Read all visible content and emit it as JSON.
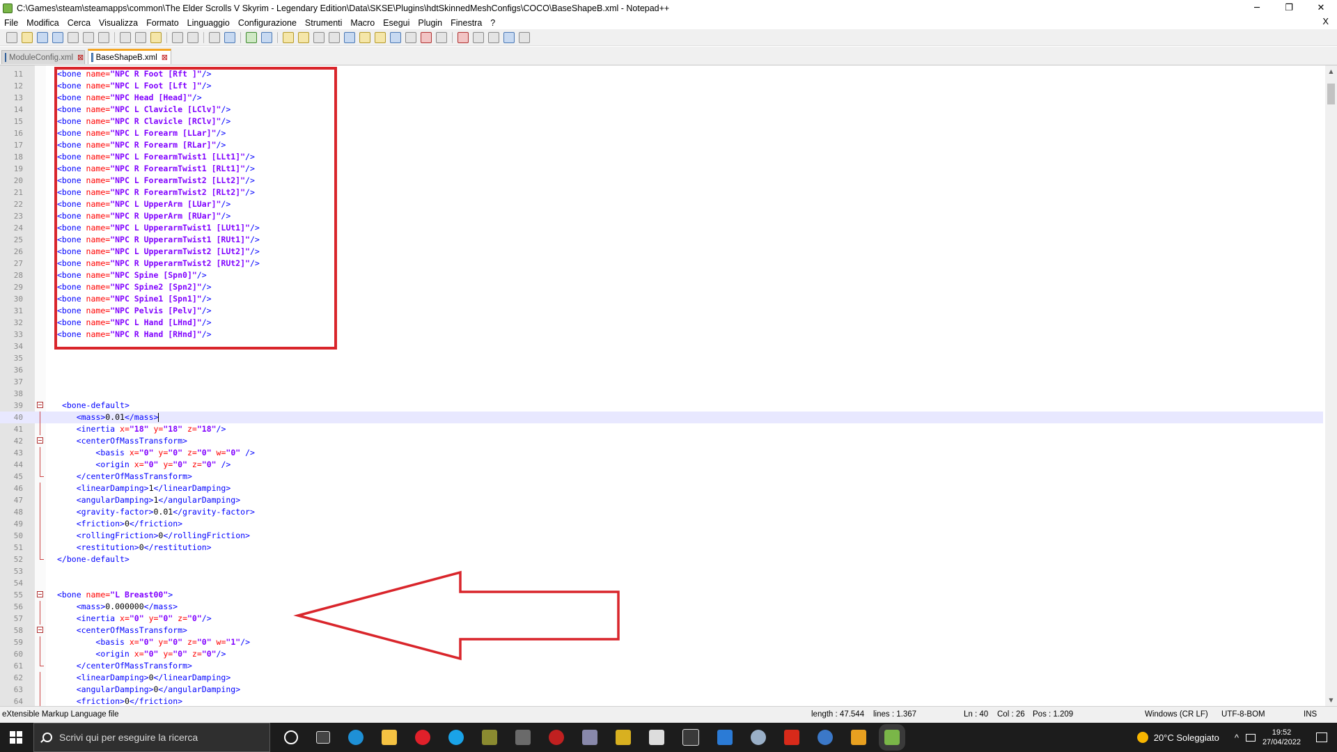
{
  "window": {
    "title": "C:\\Games\\steam\\steamapps\\common\\The Elder Scrolls V Skyrim - Legendary Edition\\Data\\SKSE\\Plugins\\hdtSkinnedMeshConfigs\\COCO\\BaseShapeB.xml - Notepad++",
    "minimize": "─",
    "restore": "❐",
    "close": "✕"
  },
  "menu": {
    "items": [
      "File",
      "Modifica",
      "Cerca",
      "Visualizza",
      "Formato",
      "Linguaggio",
      "Configurazione",
      "Strumenti",
      "Macro",
      "Esegui",
      "Plugin",
      "Finestra",
      "?"
    ],
    "close_doc": "X"
  },
  "tabs": [
    {
      "label": "ModuleConfig.xml",
      "active": false
    },
    {
      "label": "BaseShapeB.xml",
      "active": true
    }
  ],
  "tab_close_glyph": "⊠",
  "editor": {
    "current_line": 40,
    "lines": [
      {
        "n": "11",
        "indent": "",
        "tokens": [
          [
            "tg",
            "<bone "
          ],
          [
            "at",
            "name="
          ],
          [
            "av",
            "\"NPC R Foot [Rft ]\""
          ],
          [
            "tg",
            "/>"
          ]
        ]
      },
      {
        "n": "12",
        "indent": "",
        "tokens": [
          [
            "tg",
            "<bone "
          ],
          [
            "at",
            "name="
          ],
          [
            "av",
            "\"NPC L Foot [Lft ]\""
          ],
          [
            "tg",
            "/>"
          ]
        ]
      },
      {
        "n": "13",
        "indent": "",
        "tokens": [
          [
            "tg",
            "<bone "
          ],
          [
            "at",
            "name="
          ],
          [
            "av",
            "\"NPC Head [Head]\""
          ],
          [
            "tg",
            "/>"
          ]
        ]
      },
      {
        "n": "14",
        "indent": "",
        "tokens": [
          [
            "tg",
            "<bone "
          ],
          [
            "at",
            "name="
          ],
          [
            "av",
            "\"NPC L Clavicle [LClv]\""
          ],
          [
            "tg",
            "/>"
          ]
        ]
      },
      {
        "n": "15",
        "indent": "",
        "tokens": [
          [
            "tg",
            "<bone "
          ],
          [
            "at",
            "name="
          ],
          [
            "av",
            "\"NPC R Clavicle [RClv]\""
          ],
          [
            "tg",
            "/>"
          ]
        ]
      },
      {
        "n": "16",
        "indent": "",
        "tokens": [
          [
            "tg",
            "<bone "
          ],
          [
            "at",
            "name="
          ],
          [
            "av",
            "\"NPC L Forearm [LLar]\""
          ],
          [
            "tg",
            "/>"
          ]
        ]
      },
      {
        "n": "17",
        "indent": "",
        "tokens": [
          [
            "tg",
            "<bone "
          ],
          [
            "at",
            "name="
          ],
          [
            "av",
            "\"NPC R Forearm [RLar]\""
          ],
          [
            "tg",
            "/>"
          ]
        ]
      },
      {
        "n": "18",
        "indent": "",
        "tokens": [
          [
            "tg",
            "<bone "
          ],
          [
            "at",
            "name="
          ],
          [
            "av",
            "\"NPC L ForearmTwist1 [LLt1]\""
          ],
          [
            "tg",
            "/>"
          ]
        ]
      },
      {
        "n": "19",
        "indent": "",
        "tokens": [
          [
            "tg",
            "<bone "
          ],
          [
            "at",
            "name="
          ],
          [
            "av",
            "\"NPC R ForearmTwist1 [RLt1]\""
          ],
          [
            "tg",
            "/>"
          ]
        ]
      },
      {
        "n": "20",
        "indent": "",
        "tokens": [
          [
            "tg",
            "<bone "
          ],
          [
            "at",
            "name="
          ],
          [
            "av",
            "\"NPC L ForearmTwist2 [LLt2]\""
          ],
          [
            "tg",
            "/>"
          ]
        ]
      },
      {
        "n": "21",
        "indent": "",
        "tokens": [
          [
            "tg",
            "<bone "
          ],
          [
            "at",
            "name="
          ],
          [
            "av",
            "\"NPC R ForearmTwist2 [RLt2]\""
          ],
          [
            "tg",
            "/>"
          ]
        ]
      },
      {
        "n": "22",
        "indent": "",
        "tokens": [
          [
            "tg",
            "<bone "
          ],
          [
            "at",
            "name="
          ],
          [
            "av",
            "\"NPC L UpperArm [LUar]\""
          ],
          [
            "tg",
            "/>"
          ]
        ]
      },
      {
        "n": "23",
        "indent": "",
        "tokens": [
          [
            "tg",
            "<bone "
          ],
          [
            "at",
            "name="
          ],
          [
            "av",
            "\"NPC R UpperArm [RUar]\""
          ],
          [
            "tg",
            "/>"
          ]
        ]
      },
      {
        "n": "24",
        "indent": "",
        "tokens": [
          [
            "tg",
            "<bone "
          ],
          [
            "at",
            "name="
          ],
          [
            "av",
            "\"NPC L UpperarmTwist1 [LUt1]\""
          ],
          [
            "tg",
            "/>"
          ]
        ]
      },
      {
        "n": "25",
        "indent": "",
        "tokens": [
          [
            "tg",
            "<bone "
          ],
          [
            "at",
            "name="
          ],
          [
            "av",
            "\"NPC R UpperarmTwist1 [RUt1]\""
          ],
          [
            "tg",
            "/>"
          ]
        ]
      },
      {
        "n": "26",
        "indent": "",
        "tokens": [
          [
            "tg",
            "<bone "
          ],
          [
            "at",
            "name="
          ],
          [
            "av",
            "\"NPC L UpperarmTwist2 [LUt2]\""
          ],
          [
            "tg",
            "/>"
          ]
        ]
      },
      {
        "n": "27",
        "indent": "",
        "tokens": [
          [
            "tg",
            "<bone "
          ],
          [
            "at",
            "name="
          ],
          [
            "av",
            "\"NPC R UpperarmTwist2 [RUt2]\""
          ],
          [
            "tg",
            "/>"
          ]
        ]
      },
      {
        "n": "28",
        "indent": "",
        "tokens": [
          [
            "tg",
            "<bone "
          ],
          [
            "at",
            "name="
          ],
          [
            "av",
            "\"NPC Spine [Spn0]\""
          ],
          [
            "tg",
            "/>"
          ]
        ]
      },
      {
        "n": "29",
        "indent": "",
        "tokens": [
          [
            "tg",
            "<bone "
          ],
          [
            "at",
            "name="
          ],
          [
            "av",
            "\"NPC Spine2 [Spn2]\""
          ],
          [
            "tg",
            "/>"
          ]
        ]
      },
      {
        "n": "30",
        "indent": "",
        "tokens": [
          [
            "tg",
            "<bone "
          ],
          [
            "at",
            "name="
          ],
          [
            "av",
            "\"NPC Spine1 [Spn1]\""
          ],
          [
            "tg",
            "/>"
          ]
        ]
      },
      {
        "n": "31",
        "indent": "",
        "tokens": [
          [
            "tg",
            "<bone "
          ],
          [
            "at",
            "name="
          ],
          [
            "av",
            "\"NPC Pelvis [Pelv]\""
          ],
          [
            "tg",
            "/>"
          ]
        ]
      },
      {
        "n": "32",
        "indent": "",
        "tokens": [
          [
            "tg",
            "<bone "
          ],
          [
            "at",
            "name="
          ],
          [
            "av",
            "\"NPC L Hand [LHnd]\""
          ],
          [
            "tg",
            "/>"
          ]
        ]
      },
      {
        "n": "33",
        "indent": "",
        "tokens": [
          [
            "tg",
            "<bone "
          ],
          [
            "at",
            "name="
          ],
          [
            "av",
            "\"NPC R Hand [RHnd]\""
          ],
          [
            "tg",
            "/>"
          ]
        ]
      },
      {
        "n": "34",
        "indent": "",
        "tokens": []
      },
      {
        "n": "35",
        "indent": "",
        "tokens": []
      },
      {
        "n": "36",
        "indent": "",
        "tokens": []
      },
      {
        "n": "37",
        "indent": "",
        "tokens": []
      },
      {
        "n": "38",
        "indent": "",
        "tokens": []
      },
      {
        "n": "39",
        "indent": " ",
        "tokens": [
          [
            "tg",
            "<bone-default>"
          ]
        ]
      },
      {
        "n": "40",
        "indent": "    ",
        "tokens": [
          [
            "tg",
            "<mass>"
          ],
          [
            "tx",
            "0.01"
          ],
          [
            "tg",
            "</mass>"
          ]
        ]
      },
      {
        "n": "41",
        "indent": "    ",
        "tokens": [
          [
            "tg",
            "<inertia "
          ],
          [
            "at",
            "x="
          ],
          [
            "av",
            "\"18\" "
          ],
          [
            "at",
            "y="
          ],
          [
            "av",
            "\"18\" "
          ],
          [
            "at",
            "z="
          ],
          [
            "av",
            "\"18\""
          ],
          [
            "tg",
            "/>"
          ]
        ]
      },
      {
        "n": "42",
        "indent": "    ",
        "tokens": [
          [
            "tg",
            "<centerOfMassTransform>"
          ]
        ]
      },
      {
        "n": "43",
        "indent": "        ",
        "tokens": [
          [
            "tg",
            "<basis "
          ],
          [
            "at",
            "x="
          ],
          [
            "av",
            "\"0\" "
          ],
          [
            "at",
            "y="
          ],
          [
            "av",
            "\"0\" "
          ],
          [
            "at",
            "z="
          ],
          [
            "av",
            "\"0\" "
          ],
          [
            "at",
            "w="
          ],
          [
            "av",
            "\"0\" "
          ],
          [
            "tg",
            "/>"
          ]
        ]
      },
      {
        "n": "44",
        "indent": "        ",
        "tokens": [
          [
            "tg",
            "<origin "
          ],
          [
            "at",
            "x="
          ],
          [
            "av",
            "\"0\" "
          ],
          [
            "at",
            "y="
          ],
          [
            "av",
            "\"0\" "
          ],
          [
            "at",
            "z="
          ],
          [
            "av",
            "\"0\" "
          ],
          [
            "tg",
            "/>"
          ]
        ]
      },
      {
        "n": "45",
        "indent": "    ",
        "tokens": [
          [
            "tg",
            "</centerOfMassTransform>"
          ]
        ]
      },
      {
        "n": "46",
        "indent": "    ",
        "tokens": [
          [
            "tg",
            "<linearDamping>"
          ],
          [
            "tx",
            "1"
          ],
          [
            "tg",
            "</linearDamping>"
          ]
        ]
      },
      {
        "n": "47",
        "indent": "    ",
        "tokens": [
          [
            "tg",
            "<angularDamping>"
          ],
          [
            "tx",
            "1"
          ],
          [
            "tg",
            "</angularDamping>"
          ]
        ]
      },
      {
        "n": "48",
        "indent": "    ",
        "tokens": [
          [
            "tg",
            "<gravity-factor>"
          ],
          [
            "tx",
            "0.01"
          ],
          [
            "tg",
            "</gravity-factor>"
          ]
        ]
      },
      {
        "n": "49",
        "indent": "    ",
        "tokens": [
          [
            "tg",
            "<friction>"
          ],
          [
            "tx",
            "0"
          ],
          [
            "tg",
            "</friction>"
          ]
        ]
      },
      {
        "n": "50",
        "indent": "    ",
        "tokens": [
          [
            "tg",
            "<rollingFriction>"
          ],
          [
            "tx",
            "0"
          ],
          [
            "tg",
            "</rollingFriction>"
          ]
        ]
      },
      {
        "n": "51",
        "indent": "    ",
        "tokens": [
          [
            "tg",
            "<restitution>"
          ],
          [
            "tx",
            "0"
          ],
          [
            "tg",
            "</restitution>"
          ]
        ]
      },
      {
        "n": "52",
        "indent": "",
        "tokens": [
          [
            "tg",
            "</bone-default>"
          ]
        ]
      },
      {
        "n": "53",
        "indent": "",
        "tokens": []
      },
      {
        "n": "54",
        "indent": "",
        "tokens": []
      },
      {
        "n": "55",
        "indent": "",
        "tokens": [
          [
            "tg",
            "<bone "
          ],
          [
            "at",
            "name="
          ],
          [
            "av",
            "\"L Breast00\""
          ],
          [
            "tg",
            ">"
          ]
        ]
      },
      {
        "n": "56",
        "indent": "    ",
        "tokens": [
          [
            "tg",
            "<mass>"
          ],
          [
            "tx",
            "0.000000"
          ],
          [
            "tg",
            "</mass>"
          ]
        ]
      },
      {
        "n": "57",
        "indent": "    ",
        "tokens": [
          [
            "tg",
            "<inertia "
          ],
          [
            "at",
            "x="
          ],
          [
            "av",
            "\"0\" "
          ],
          [
            "at",
            "y="
          ],
          [
            "av",
            "\"0\" "
          ],
          [
            "at",
            "z="
          ],
          [
            "av",
            "\"0\""
          ],
          [
            "tg",
            "/>"
          ]
        ]
      },
      {
        "n": "58",
        "indent": "    ",
        "tokens": [
          [
            "tg",
            "<centerOfMassTransform>"
          ]
        ]
      },
      {
        "n": "59",
        "indent": "        ",
        "tokens": [
          [
            "tg",
            "<basis "
          ],
          [
            "at",
            "x="
          ],
          [
            "av",
            "\"0\" "
          ],
          [
            "at",
            "y="
          ],
          [
            "av",
            "\"0\" "
          ],
          [
            "at",
            "z="
          ],
          [
            "av",
            "\"0\" "
          ],
          [
            "at",
            "w="
          ],
          [
            "av",
            "\"1\""
          ],
          [
            "tg",
            "/>"
          ]
        ]
      },
      {
        "n": "60",
        "indent": "        ",
        "tokens": [
          [
            "tg",
            "<origin "
          ],
          [
            "at",
            "x="
          ],
          [
            "av",
            "\"0\" "
          ],
          [
            "at",
            "y="
          ],
          [
            "av",
            "\"0\" "
          ],
          [
            "at",
            "z="
          ],
          [
            "av",
            "\"0\""
          ],
          [
            "tg",
            "/>"
          ]
        ]
      },
      {
        "n": "61",
        "indent": "    ",
        "tokens": [
          [
            "tg",
            "</centerOfMassTransform>"
          ]
        ]
      },
      {
        "n": "62",
        "indent": "    ",
        "tokens": [
          [
            "tg",
            "<linearDamping>"
          ],
          [
            "tx",
            "0"
          ],
          [
            "tg",
            "</linearDamping>"
          ]
        ]
      },
      {
        "n": "63",
        "indent": "    ",
        "tokens": [
          [
            "tg",
            "<angularDamping>"
          ],
          [
            "tx",
            "0"
          ],
          [
            "tg",
            "</angularDamping>"
          ]
        ]
      },
      {
        "n": "64",
        "indent": "    ",
        "tokens": [
          [
            "tg",
            "<friction>"
          ],
          [
            "tx",
            "0"
          ],
          [
            "tg",
            "</friction>"
          ]
        ]
      }
    ],
    "fold_open_lines": [
      "39",
      "42",
      "55",
      "58"
    ],
    "fold_end_lines": [
      "45",
      "52",
      "61"
    ]
  },
  "status": {
    "filetype": "eXtensible Markup Language file",
    "length": "length : 47.544",
    "lines": "lines : 1.367",
    "ln": "Ln : 40",
    "col": "Col : 26",
    "pos": "Pos : 1.209",
    "eol": "Windows (CR LF)",
    "encoding": "UTF-8-BOM",
    "mode": "INS"
  },
  "taskbar": {
    "search_placeholder": "Scrivi qui per eseguire la ricerca",
    "weather": "20°C  Soleggiato",
    "time": "19:52",
    "date": "27/04/2022"
  },
  "colors": {
    "tag": "#0000ff",
    "attribute": "#ff0000",
    "attr_value": "#8000ff",
    "annotation": "#d9252b",
    "current_line": "#e8e8ff"
  }
}
